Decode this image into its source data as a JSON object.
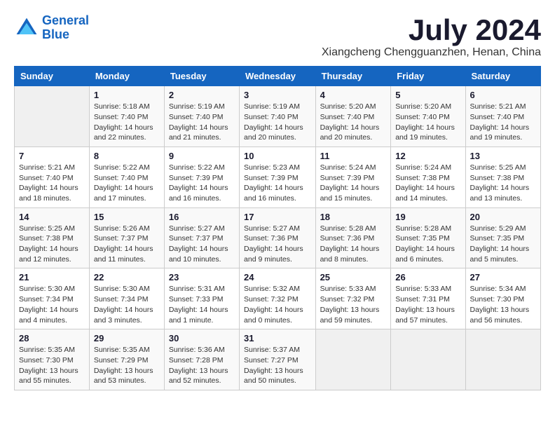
{
  "logo": {
    "text_general": "General",
    "text_blue": "Blue"
  },
  "title": "July 2024",
  "location": "Xiangcheng Chengguanzhen, Henan, China",
  "weekdays": [
    "Sunday",
    "Monday",
    "Tuesday",
    "Wednesday",
    "Thursday",
    "Friday",
    "Saturday"
  ],
  "weeks": [
    [
      {
        "day": "",
        "info": ""
      },
      {
        "day": "1",
        "info": "Sunrise: 5:18 AM\nSunset: 7:40 PM\nDaylight: 14 hours\nand 22 minutes."
      },
      {
        "day": "2",
        "info": "Sunrise: 5:19 AM\nSunset: 7:40 PM\nDaylight: 14 hours\nand 21 minutes."
      },
      {
        "day": "3",
        "info": "Sunrise: 5:19 AM\nSunset: 7:40 PM\nDaylight: 14 hours\nand 20 minutes."
      },
      {
        "day": "4",
        "info": "Sunrise: 5:20 AM\nSunset: 7:40 PM\nDaylight: 14 hours\nand 20 minutes."
      },
      {
        "day": "5",
        "info": "Sunrise: 5:20 AM\nSunset: 7:40 PM\nDaylight: 14 hours\nand 19 minutes."
      },
      {
        "day": "6",
        "info": "Sunrise: 5:21 AM\nSunset: 7:40 PM\nDaylight: 14 hours\nand 19 minutes."
      }
    ],
    [
      {
        "day": "7",
        "info": "Sunrise: 5:21 AM\nSunset: 7:40 PM\nDaylight: 14 hours\nand 18 minutes."
      },
      {
        "day": "8",
        "info": "Sunrise: 5:22 AM\nSunset: 7:40 PM\nDaylight: 14 hours\nand 17 minutes."
      },
      {
        "day": "9",
        "info": "Sunrise: 5:22 AM\nSunset: 7:39 PM\nDaylight: 14 hours\nand 16 minutes."
      },
      {
        "day": "10",
        "info": "Sunrise: 5:23 AM\nSunset: 7:39 PM\nDaylight: 14 hours\nand 16 minutes."
      },
      {
        "day": "11",
        "info": "Sunrise: 5:24 AM\nSunset: 7:39 PM\nDaylight: 14 hours\nand 15 minutes."
      },
      {
        "day": "12",
        "info": "Sunrise: 5:24 AM\nSunset: 7:38 PM\nDaylight: 14 hours\nand 14 minutes."
      },
      {
        "day": "13",
        "info": "Sunrise: 5:25 AM\nSunset: 7:38 PM\nDaylight: 14 hours\nand 13 minutes."
      }
    ],
    [
      {
        "day": "14",
        "info": "Sunrise: 5:25 AM\nSunset: 7:38 PM\nDaylight: 14 hours\nand 12 minutes."
      },
      {
        "day": "15",
        "info": "Sunrise: 5:26 AM\nSunset: 7:37 PM\nDaylight: 14 hours\nand 11 minutes."
      },
      {
        "day": "16",
        "info": "Sunrise: 5:27 AM\nSunset: 7:37 PM\nDaylight: 14 hours\nand 10 minutes."
      },
      {
        "day": "17",
        "info": "Sunrise: 5:27 AM\nSunset: 7:36 PM\nDaylight: 14 hours\nand 9 minutes."
      },
      {
        "day": "18",
        "info": "Sunrise: 5:28 AM\nSunset: 7:36 PM\nDaylight: 14 hours\nand 8 minutes."
      },
      {
        "day": "19",
        "info": "Sunrise: 5:28 AM\nSunset: 7:35 PM\nDaylight: 14 hours\nand 6 minutes."
      },
      {
        "day": "20",
        "info": "Sunrise: 5:29 AM\nSunset: 7:35 PM\nDaylight: 14 hours\nand 5 minutes."
      }
    ],
    [
      {
        "day": "21",
        "info": "Sunrise: 5:30 AM\nSunset: 7:34 PM\nDaylight: 14 hours\nand 4 minutes."
      },
      {
        "day": "22",
        "info": "Sunrise: 5:30 AM\nSunset: 7:34 PM\nDaylight: 14 hours\nand 3 minutes."
      },
      {
        "day": "23",
        "info": "Sunrise: 5:31 AM\nSunset: 7:33 PM\nDaylight: 14 hours\nand 1 minute."
      },
      {
        "day": "24",
        "info": "Sunrise: 5:32 AM\nSunset: 7:32 PM\nDaylight: 14 hours\nand 0 minutes."
      },
      {
        "day": "25",
        "info": "Sunrise: 5:33 AM\nSunset: 7:32 PM\nDaylight: 13 hours\nand 59 minutes."
      },
      {
        "day": "26",
        "info": "Sunrise: 5:33 AM\nSunset: 7:31 PM\nDaylight: 13 hours\nand 57 minutes."
      },
      {
        "day": "27",
        "info": "Sunrise: 5:34 AM\nSunset: 7:30 PM\nDaylight: 13 hours\nand 56 minutes."
      }
    ],
    [
      {
        "day": "28",
        "info": "Sunrise: 5:35 AM\nSunset: 7:30 PM\nDaylight: 13 hours\nand 55 minutes."
      },
      {
        "day": "29",
        "info": "Sunrise: 5:35 AM\nSunset: 7:29 PM\nDaylight: 13 hours\nand 53 minutes."
      },
      {
        "day": "30",
        "info": "Sunrise: 5:36 AM\nSunset: 7:28 PM\nDaylight: 13 hours\nand 52 minutes."
      },
      {
        "day": "31",
        "info": "Sunrise: 5:37 AM\nSunset: 7:27 PM\nDaylight: 13 hours\nand 50 minutes."
      },
      {
        "day": "",
        "info": ""
      },
      {
        "day": "",
        "info": ""
      },
      {
        "day": "",
        "info": ""
      }
    ]
  ]
}
